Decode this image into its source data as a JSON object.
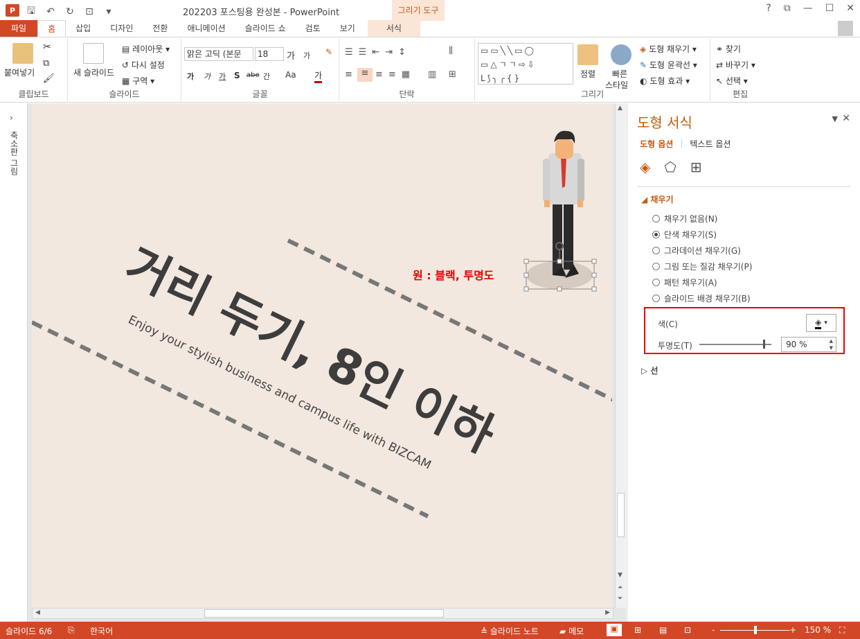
{
  "window": {
    "title": "202203 포스팅용 완성본 - PowerPoint",
    "tool_tab_header": "그리기 도구",
    "help": "?",
    "logo": "P"
  },
  "tabs": [
    {
      "label": "파일"
    },
    {
      "label": "홈"
    },
    {
      "label": "삽입"
    },
    {
      "label": "디자인"
    },
    {
      "label": "전환"
    },
    {
      "label": "애니메이션"
    },
    {
      "label": "슬라이드 쇼"
    },
    {
      "label": "검토"
    },
    {
      "label": "보기"
    },
    {
      "label": "서식"
    }
  ],
  "ribbon": {
    "clipboard": {
      "label": "클립보드",
      "paste": "붙여넣기"
    },
    "slides": {
      "label": "슬라이드",
      "new_slide": "새 슬라이드",
      "layout": "레이아웃",
      "reset": "다시 설정",
      "section": "구역"
    },
    "font": {
      "label": "글꼴",
      "font_name": "맑은 고딕 (본문",
      "font_size": "18",
      "grow": "가",
      "shrink": "가",
      "bold": "가",
      "italic": "가",
      "underline": "가",
      "shadow": "S",
      "strike": "abe",
      "spacing": "간",
      "case": "Aa",
      "color": "가"
    },
    "paragraph": {
      "label": "단락"
    },
    "drawing": {
      "label": "그리기",
      "arrange": "정렬",
      "quick_style_1": "빠른",
      "quick_style_2": "스타일",
      "fill": "도형 채우기",
      "outline": "도형 윤곽선",
      "effect": "도형 효과",
      "shape_row1": "▭▭╲╲▭◯",
      "shape_row2": "▭△ㄱㄱ⇨⇩",
      "shape_row3": "ᒪ⟆╮╭{}"
    },
    "editing": {
      "label": "편집",
      "find": "찾기",
      "replace": "바꾸기",
      "select": "선택"
    }
  },
  "left_pane": {
    "label": "축소판 그림"
  },
  "slide": {
    "title_text": "거리 두기, 8인 이하",
    "subtitle_text": "Enjoy your stylish business and campus life with BIZCAM",
    "annotation": "원 : 블랙, 투명도"
  },
  "format_pane": {
    "title": "도형 서식",
    "tab_shape": "도형 옵션",
    "tab_text": "텍스트 옵션",
    "section_fill": "채우기",
    "section_line": "선",
    "options": [
      {
        "label": "채우기 없음(N)",
        "checked": false
      },
      {
        "label": "단색 채우기(S)",
        "checked": true
      },
      {
        "label": "그라데이션 채우기(G)",
        "checked": false
      },
      {
        "label": "그림 또는 질감 채우기(P)",
        "checked": false
      },
      {
        "label": "패턴 채우기(A)",
        "checked": false
      },
      {
        "label": "슬라이드 배경 채우기(B)",
        "checked": false
      }
    ],
    "color_label": "색(C)",
    "transparency_label": "투명도(T)",
    "transparency_value": "90 %",
    "transparency_fraction": 0.9
  },
  "status": {
    "slide": "슬라이드 6/6",
    "language": "한국어",
    "notes": "슬라이드 노트",
    "comments": "메모",
    "zoom": "150 %",
    "zoom_minus": "-",
    "zoom_plus": "+"
  },
  "colors": {
    "accent": "#d24726",
    "pane_accent": "#c55a11",
    "slide_bg": "#f2e8df",
    "annotation": "#e60000",
    "highlight_box": "#ee0000"
  }
}
